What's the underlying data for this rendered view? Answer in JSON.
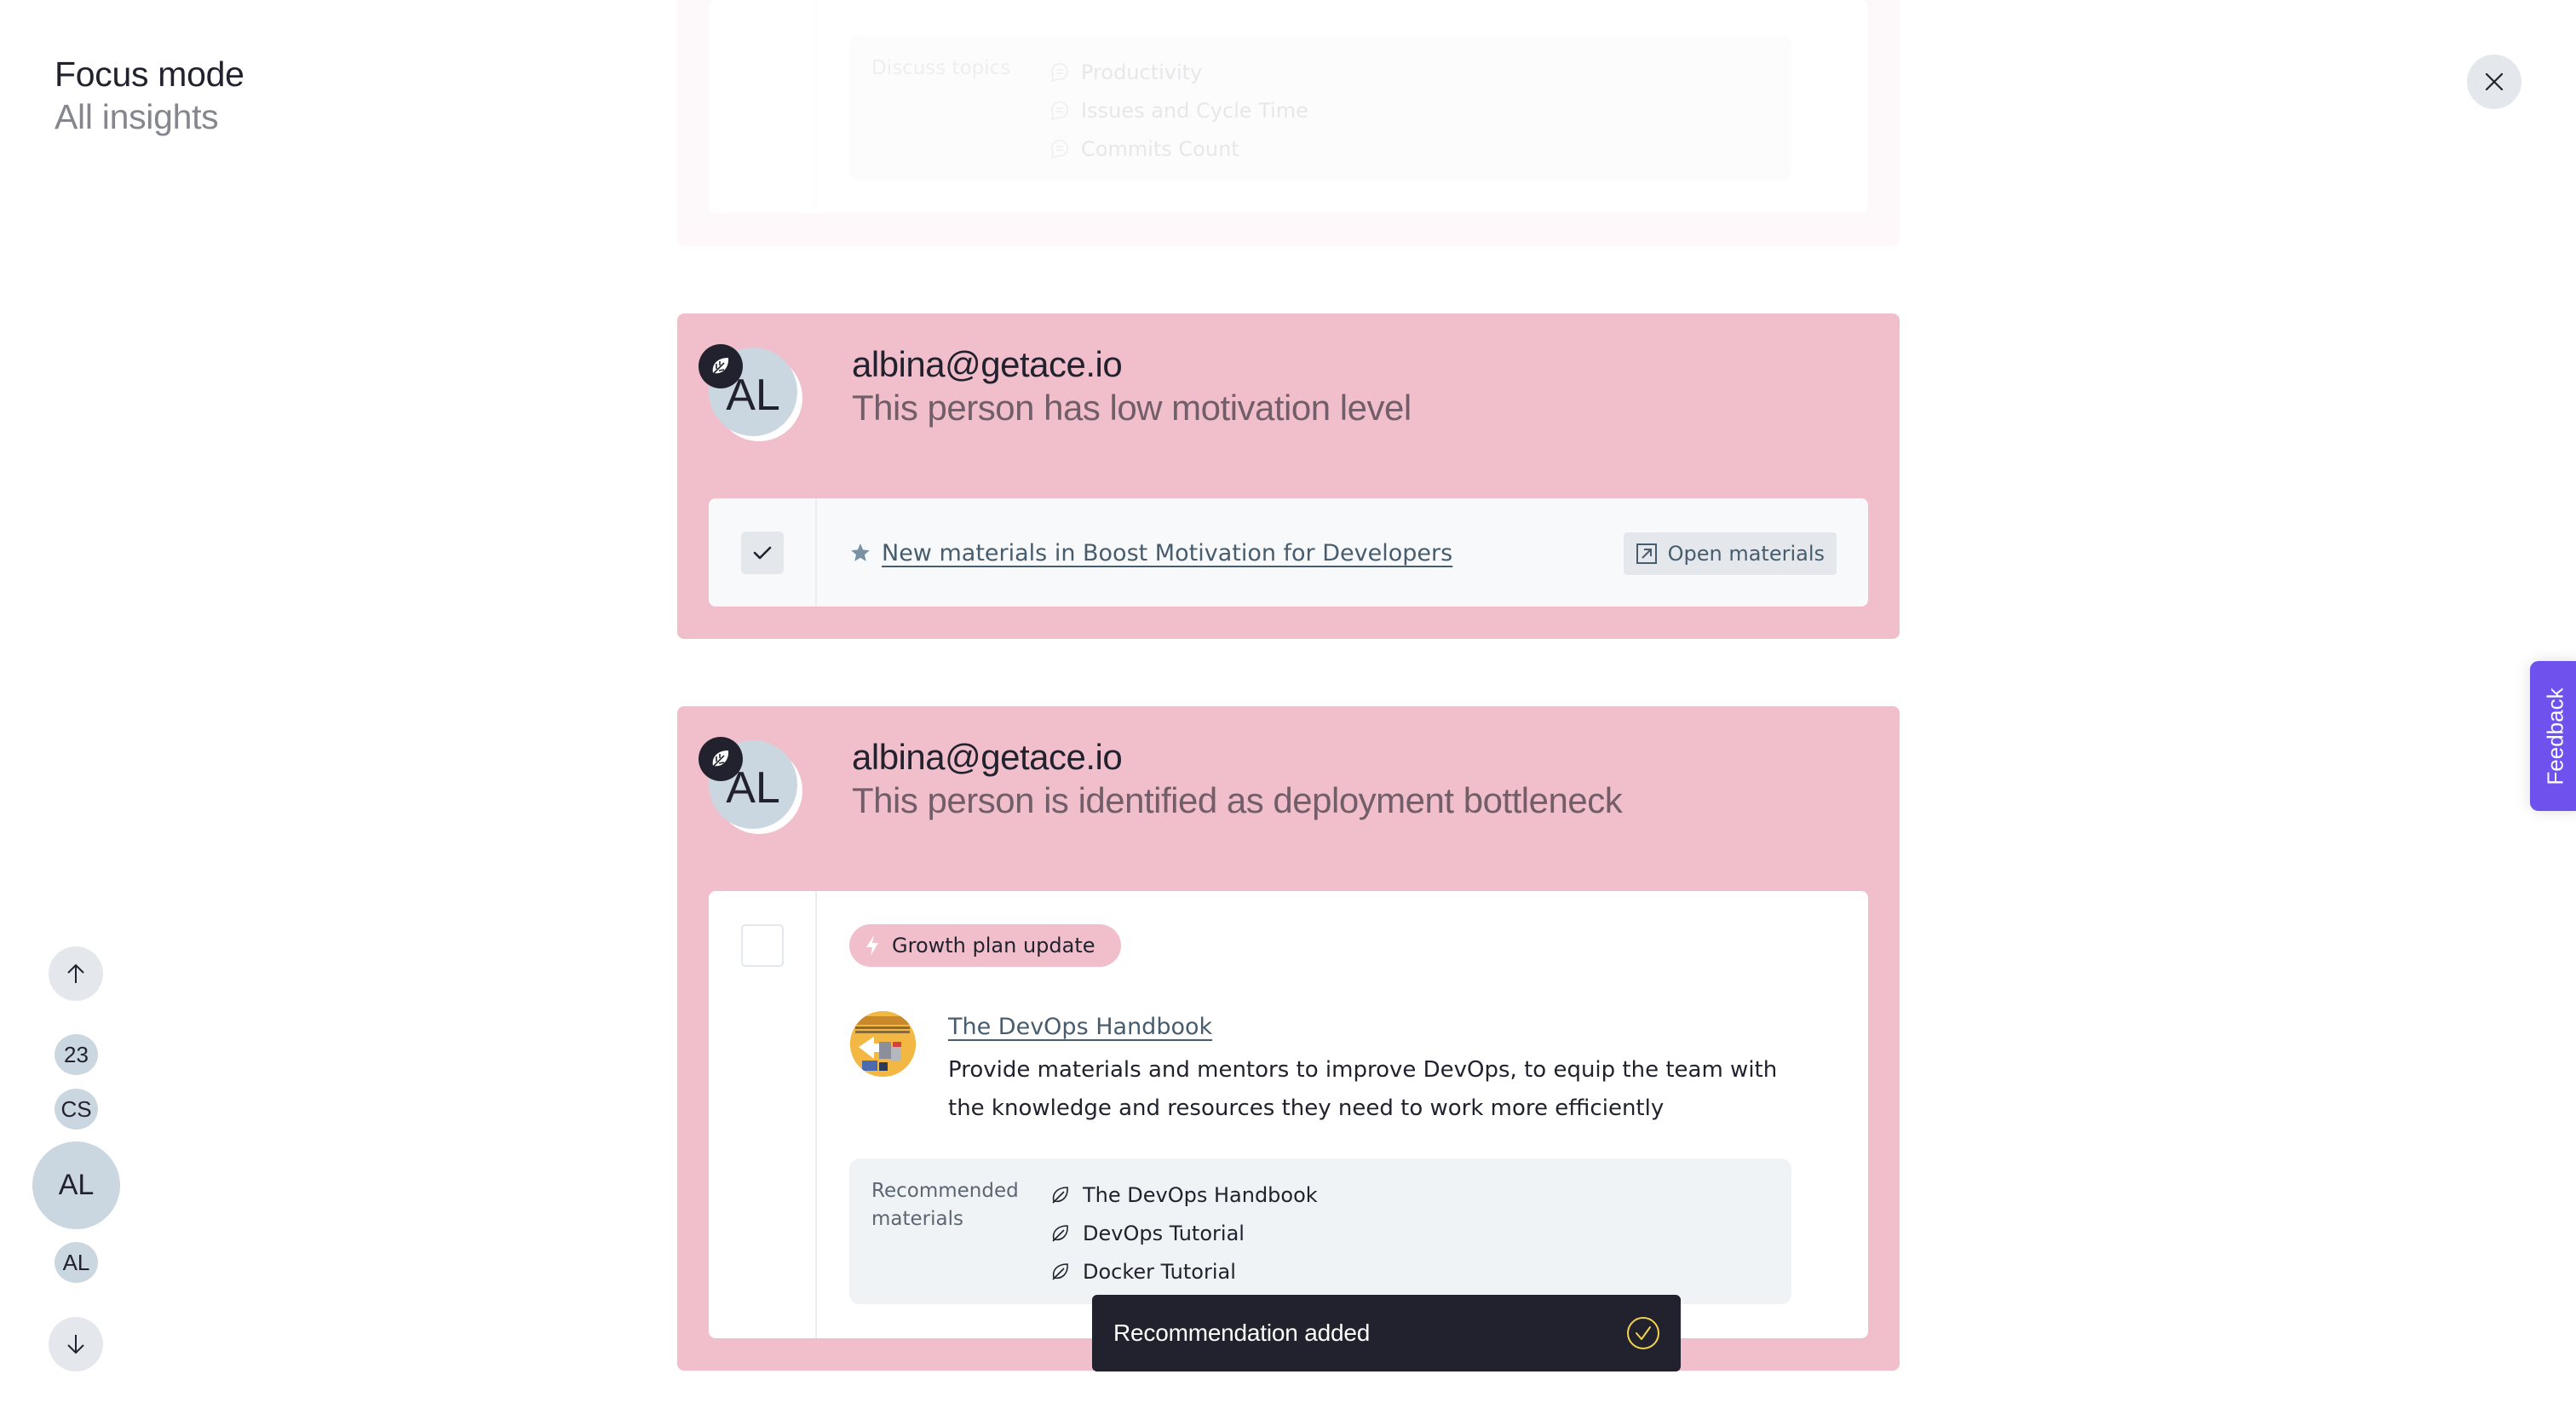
{
  "header": {
    "title": "Focus mode",
    "subtitle": "All insights",
    "close_icon": "close-icon"
  },
  "colors": {
    "card_background": "#f1bfcb",
    "avatar_background": "#cbd7e0",
    "dark": "#22222f",
    "link": "#475c6d",
    "feedback": "#6f52ed",
    "toast_check": "#f2d34f"
  },
  "cards": [
    {
      "state": "faded",
      "discuss_topics": {
        "label": "Discuss topics",
        "icon": "chat-bubble-icon",
        "items": [
          "Productivity",
          "Issues and Cycle Time",
          "Commits Count"
        ]
      }
    },
    {
      "avatar_initials": "AL",
      "badge_icon": "leaf-icon",
      "email": "albina@getace.io",
      "insight": "This person has low motivation level",
      "recommendation": {
        "checked": true,
        "icon": "star-icon",
        "link_text": "New materials in Boost Motivation for Developers",
        "button_label": "Open materials",
        "button_icon": "external-link-icon"
      }
    },
    {
      "avatar_initials": "AL",
      "badge_icon": "leaf-icon",
      "email": "albina@getace.io",
      "insight": "This person is identified as deployment bottleneck",
      "recommendation": {
        "checked": false,
        "badge_label": "Growth plan update",
        "badge_icon": "lightning-icon",
        "book_title": "The DevOps Handbook",
        "book_description": "Provide materials and mentors to improve DevOps, to equip the team with the knowledge and resources they need to work more efficiently",
        "materials_label": "Recommended materials",
        "materials": [
          "The DevOps Handbook",
          "DevOps Tutorial",
          "Docker Tutorial"
        ]
      }
    }
  ],
  "toast": {
    "message": "Recommendation added",
    "icon": "check-circle-icon"
  },
  "side_nav": {
    "up_icon": "arrow-up-icon",
    "down_icon": "arrow-down-icon",
    "items": [
      {
        "label": "23",
        "active": false
      },
      {
        "label": "CS",
        "active": false
      },
      {
        "label": "AL",
        "active": true
      },
      {
        "label": "AL",
        "active": false
      }
    ]
  },
  "feedback": {
    "label": "Feedback"
  }
}
